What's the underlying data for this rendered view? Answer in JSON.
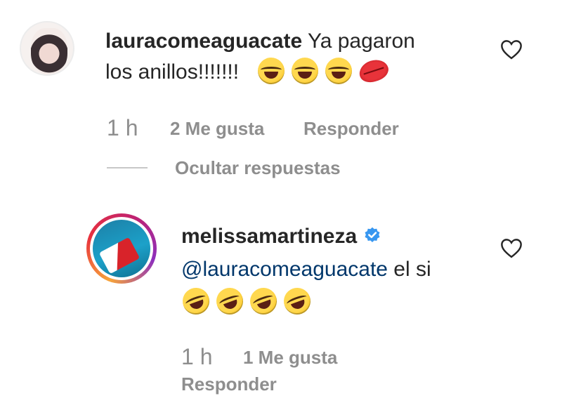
{
  "comment": {
    "username": "lauracomeaguacate",
    "text_line1": "Ya pagaron",
    "text_line2": "los anillos!!!!!!!",
    "emojis": [
      "face-with-tears-of-joy",
      "face-with-tears-of-joy",
      "face-with-tears-of-joy",
      "kiss-mark"
    ],
    "time": "1 h",
    "likes": "2 Me gusta",
    "reply_label": "Responder",
    "hide_replies_label": "Ocultar respuestas"
  },
  "reply": {
    "username": "melissamartineza",
    "verified": true,
    "mention": "@lauracomeaguacate",
    "text": " el si",
    "emojis": [
      "rolling-on-the-floor-laughing",
      "rolling-on-the-floor-laughing",
      "rolling-on-the-floor-laughing",
      "rolling-on-the-floor-laughing"
    ],
    "time": "1 h",
    "likes": "1 Me gusta",
    "reply_label": "Responder"
  },
  "colors": {
    "text": "#262626",
    "muted": "#8e8e8e",
    "mention": "#00376b",
    "verified": "#3897f0"
  }
}
